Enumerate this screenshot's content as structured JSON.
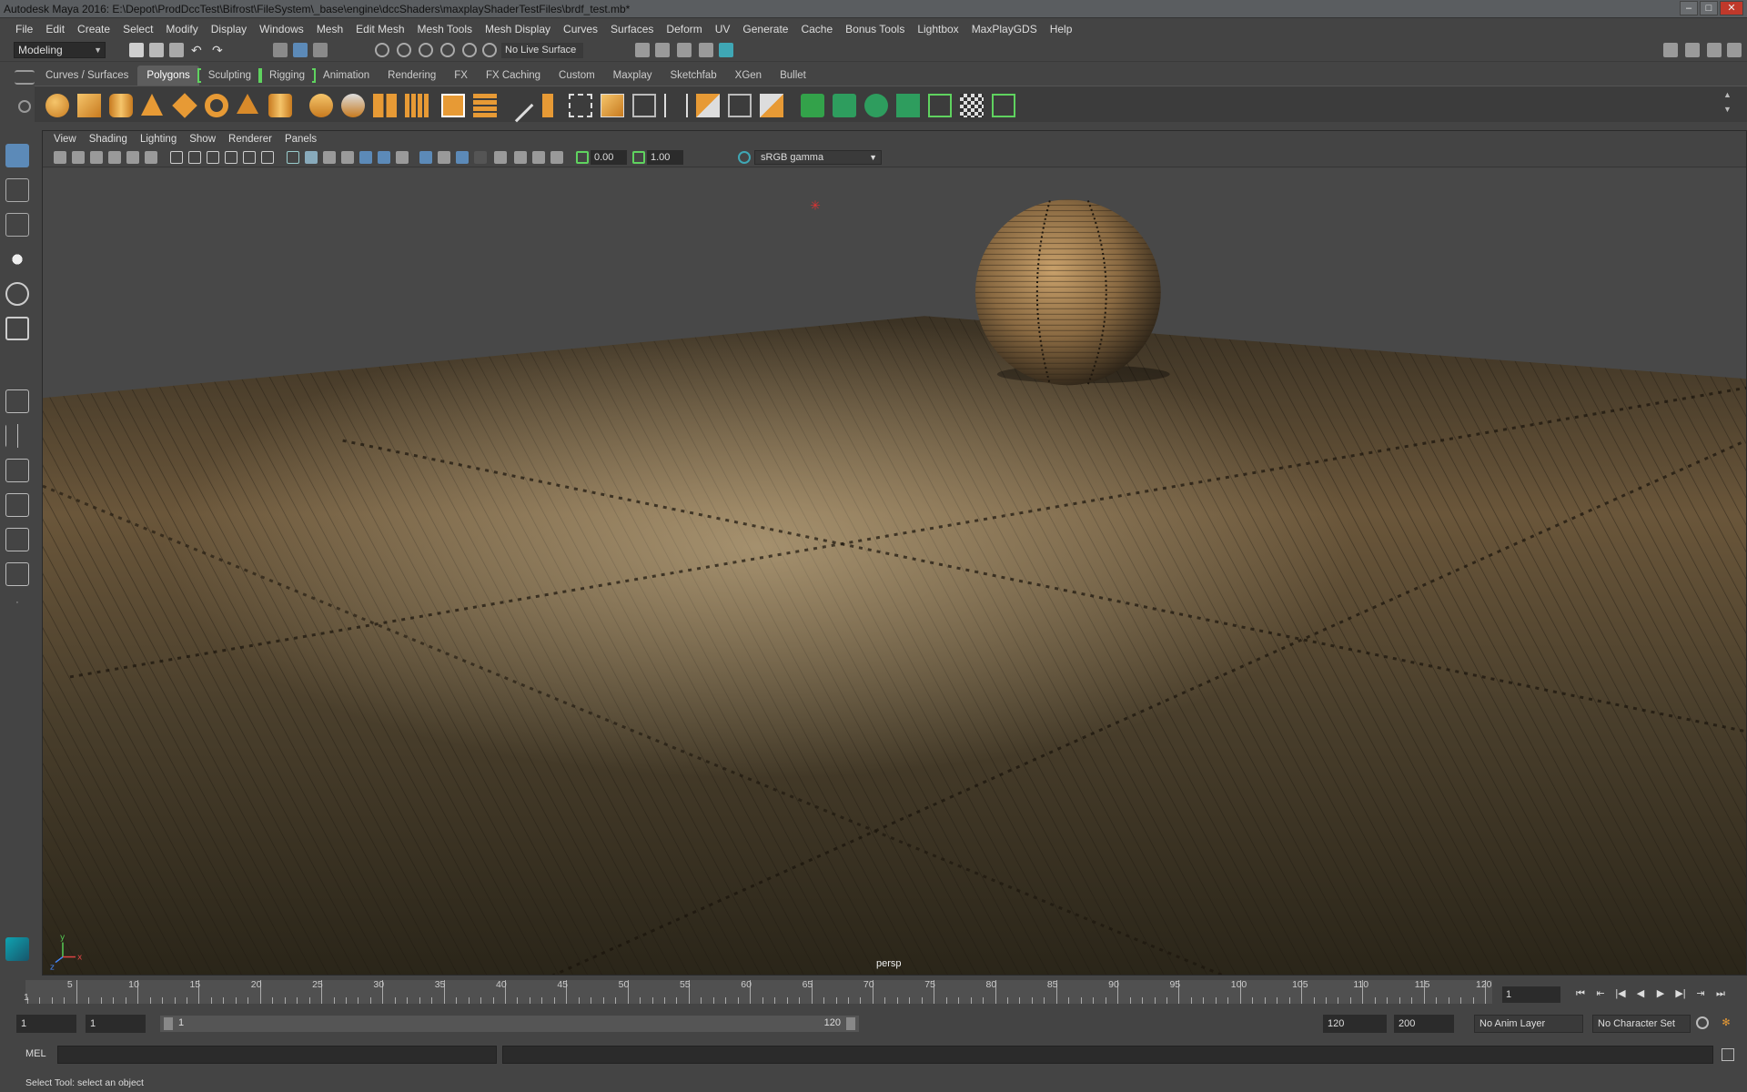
{
  "window": {
    "title": "Autodesk Maya 2016: E:\\Depot\\ProdDccTest\\Bifrost\\FileSystem\\_base\\engine\\dccShaders\\maxplayShaderTestFiles\\brdf_test.mb*",
    "minimize": "–",
    "maximize": "□",
    "close": "✕"
  },
  "menubar": {
    "items": [
      "File",
      "Edit",
      "Create",
      "Select",
      "Modify",
      "Display",
      "Windows",
      "Mesh",
      "Edit Mesh",
      "Mesh Tools",
      "Mesh Display",
      "Curves",
      "Surfaces",
      "Deform",
      "UV",
      "Generate",
      "Cache",
      "Bonus Tools",
      "Lightbox",
      "MaxPlayGDS",
      "Help"
    ]
  },
  "statusline": {
    "mode": "Modeling",
    "live_surface": "No Live Surface"
  },
  "shelf": {
    "tabs": [
      "Curves / Surfaces",
      "Polygons",
      "Sculpting",
      "Rigging",
      "Animation",
      "Rendering",
      "FX",
      "FX Caching",
      "Custom",
      "Maxplay",
      "Sketchfab",
      "XGen",
      "Bullet"
    ],
    "active_tab": "Polygons"
  },
  "viewport": {
    "menus": [
      "View",
      "Shading",
      "Lighting",
      "Show",
      "Renderer",
      "Panels"
    ],
    "exposure": "0.00",
    "gamma": "1.00",
    "color_management": "sRGB gamma",
    "camera_label": "persp",
    "axis_labels": {
      "y": "y",
      "x": "x",
      "z": "z"
    }
  },
  "timeline": {
    "ticks": [
      "5",
      "10",
      "15",
      "20",
      "25",
      "30",
      "35",
      "40",
      "45",
      "50",
      "55",
      "60",
      "65",
      "70",
      "75",
      "80",
      "85",
      "90",
      "95",
      "100",
      "105",
      "110",
      "115",
      "120"
    ],
    "start_tick": "1",
    "current_frame": "1",
    "playback_icons": [
      "⏮",
      "⇤",
      "|◀",
      "◀",
      "▶",
      "▶|",
      "⇥",
      "⏭"
    ]
  },
  "range": {
    "start": "1",
    "playback_start": "1",
    "slider_start": "1",
    "slider_end": "120",
    "playback_end": "120",
    "end": "200",
    "anim_layer": "No Anim Layer",
    "character_set": "No Character Set"
  },
  "command": {
    "language": "MEL"
  },
  "help": {
    "text": "Select Tool: select an object"
  }
}
